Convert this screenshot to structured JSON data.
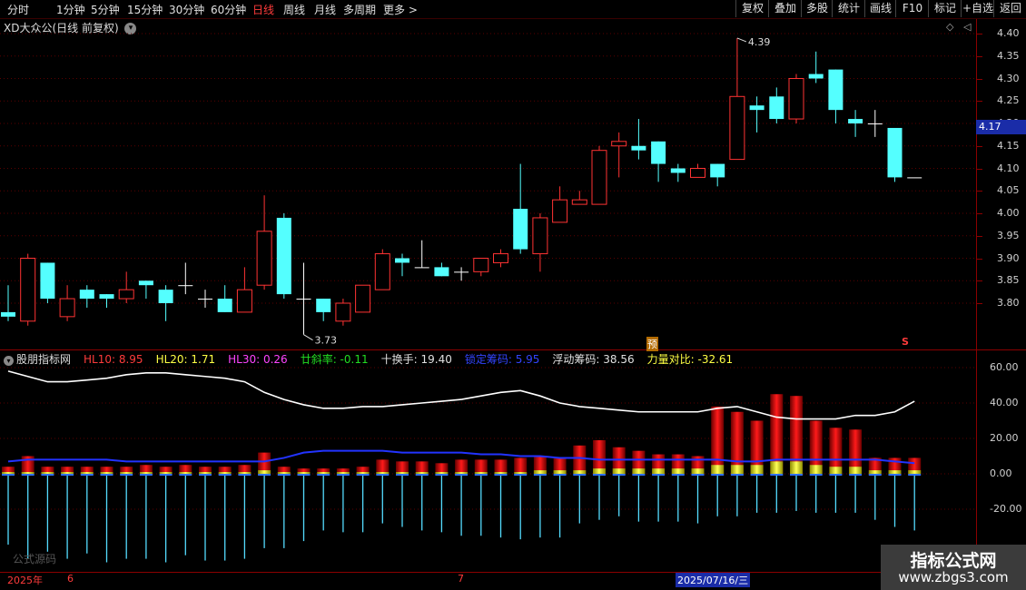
{
  "toolbar": {
    "periods": [
      "分时",
      "1分钟",
      "5分钟",
      "15分钟",
      "30分钟",
      "60分钟",
      "日线",
      "周线",
      "月线",
      "多周期",
      "更多 >"
    ],
    "active_period": "日线",
    "buttons": [
      "复权",
      "叠加",
      "多股",
      "统计",
      "画线",
      "F10",
      "标记",
      "+自选",
      "返回"
    ]
  },
  "chart": {
    "title": "XD大众公(日线 前复权)",
    "current_price_tag": "4.17",
    "high_label": "4.39",
    "low_label": "3.73",
    "marker_pre": "预",
    "marker_s": "S"
  },
  "indicator": {
    "name": "股朋指标网",
    "items": [
      {
        "label": "HL10:",
        "value": "8.95",
        "color": "#ff3b3b"
      },
      {
        "label": "HL20:",
        "value": "1.71",
        "color": "#ffff44"
      },
      {
        "label": "HL30:",
        "value": "0.26",
        "color": "#ff44ff"
      },
      {
        "label": "廿斜率:",
        "value": "-0.11",
        "color": "#22dd22"
      },
      {
        "label": "十换手:",
        "value": "19.40",
        "color": "#e0e0e0"
      },
      {
        "label": "锁定筹码:",
        "value": "5.95",
        "color": "#3344ff"
      },
      {
        "label": "浮动筹码:",
        "value": "38.56",
        "color": "#e0e0e0"
      },
      {
        "label": "力量对比:",
        "value": "-32.61",
        "color": "#ffff44"
      }
    ]
  },
  "dates": {
    "year": "2025年",
    "m6": "6",
    "m7": "7",
    "highlight": "2025/07/16/三"
  },
  "watermark": "公式源码",
  "logo": {
    "line1": "指标公式网",
    "line2": "www.zbgs3.com"
  },
  "chart_data": {
    "type": "candlestick",
    "price_axis": {
      "ticks": [
        3.8,
        3.85,
        3.9,
        3.95,
        4.0,
        4.05,
        4.1,
        4.15,
        4.2,
        4.25,
        4.3,
        4.35,
        4.4
      ],
      "range": [
        3.72,
        4.42
      ]
    },
    "candles": [
      {
        "o": 3.78,
        "h": 3.84,
        "l": 3.76,
        "c": 3.77
      },
      {
        "o": 3.76,
        "h": 3.91,
        "l": 3.75,
        "c": 3.9
      },
      {
        "o": 3.89,
        "h": 3.89,
        "l": 3.8,
        "c": 3.81
      },
      {
        "o": 3.77,
        "h": 3.84,
        "l": 3.76,
        "c": 3.81
      },
      {
        "o": 3.83,
        "h": 3.84,
        "l": 3.79,
        "c": 3.81
      },
      {
        "o": 3.82,
        "h": 3.82,
        "l": 3.79,
        "c": 3.81
      },
      {
        "o": 3.81,
        "h": 3.87,
        "l": 3.8,
        "c": 3.83
      },
      {
        "o": 3.85,
        "h": 3.85,
        "l": 3.81,
        "c": 3.84
      },
      {
        "o": 3.83,
        "h": 3.84,
        "l": 3.76,
        "c": 3.8
      },
      {
        "o": 3.84,
        "h": 3.89,
        "l": 3.82,
        "c": 3.84
      },
      {
        "o": 3.81,
        "h": 3.83,
        "l": 3.79,
        "c": 3.81
      },
      {
        "o": 3.81,
        "h": 3.84,
        "l": 3.78,
        "c": 3.78
      },
      {
        "o": 3.78,
        "h": 3.88,
        "l": 3.78,
        "c": 3.83
      },
      {
        "o": 3.84,
        "h": 4.04,
        "l": 3.83,
        "c": 3.96
      },
      {
        "o": 3.99,
        "h": 4.0,
        "l": 3.81,
        "c": 3.82
      },
      {
        "o": 3.81,
        "h": 3.89,
        "l": 3.73,
        "c": 3.81
      },
      {
        "o": 3.81,
        "h": 3.81,
        "l": 3.76,
        "c": 3.78
      },
      {
        "o": 3.76,
        "h": 3.81,
        "l": 3.75,
        "c": 3.8
      },
      {
        "o": 3.78,
        "h": 3.84,
        "l": 3.78,
        "c": 3.84
      },
      {
        "o": 3.83,
        "h": 3.92,
        "l": 3.83,
        "c": 3.91
      },
      {
        "o": 3.9,
        "h": 3.91,
        "l": 3.86,
        "c": 3.89
      },
      {
        "o": 3.88,
        "h": 3.94,
        "l": 3.88,
        "c": 3.88
      },
      {
        "o": 3.88,
        "h": 3.89,
        "l": 3.86,
        "c": 3.86
      },
      {
        "o": 3.87,
        "h": 3.88,
        "l": 3.85,
        "c": 3.87
      },
      {
        "o": 3.87,
        "h": 3.9,
        "l": 3.86,
        "c": 3.9
      },
      {
        "o": 3.89,
        "h": 3.92,
        "l": 3.88,
        "c": 3.91
      },
      {
        "o": 4.01,
        "h": 4.11,
        "l": 3.91,
        "c": 3.92
      },
      {
        "o": 3.91,
        "h": 4.0,
        "l": 3.87,
        "c": 3.99
      },
      {
        "o": 3.98,
        "h": 4.06,
        "l": 3.98,
        "c": 4.03
      },
      {
        "o": 4.02,
        "h": 4.05,
        "l": 4.02,
        "c": 4.03
      },
      {
        "o": 4.02,
        "h": 4.15,
        "l": 4.02,
        "c": 4.14
      },
      {
        "o": 4.15,
        "h": 4.18,
        "l": 4.08,
        "c": 4.16
      },
      {
        "o": 4.15,
        "h": 4.21,
        "l": 4.12,
        "c": 4.14
      },
      {
        "o": 4.16,
        "h": 4.16,
        "l": 4.07,
        "c": 4.11
      },
      {
        "o": 4.1,
        "h": 4.11,
        "l": 4.07,
        "c": 4.09
      },
      {
        "o": 4.08,
        "h": 4.11,
        "l": 4.08,
        "c": 4.1
      },
      {
        "o": 4.11,
        "h": 4.11,
        "l": 4.06,
        "c": 4.08
      },
      {
        "o": 4.12,
        "h": 4.39,
        "l": 4.12,
        "c": 4.26
      },
      {
        "o": 4.24,
        "h": 4.26,
        "l": 4.18,
        "c": 4.23
      },
      {
        "o": 4.26,
        "h": 4.28,
        "l": 4.2,
        "c": 4.21
      },
      {
        "o": 4.21,
        "h": 4.31,
        "l": 4.2,
        "c": 4.3
      },
      {
        "o": 4.31,
        "h": 4.36,
        "l": 4.29,
        "c": 4.3
      },
      {
        "o": 4.32,
        "h": 4.32,
        "l": 4.2,
        "c": 4.23
      },
      {
        "o": 4.21,
        "h": 4.23,
        "l": 4.17,
        "c": 4.2
      },
      {
        "o": 4.2,
        "h": 4.23,
        "l": 4.17,
        "c": 4.2
      },
      {
        "o": 4.19,
        "h": 4.19,
        "l": 4.07,
        "c": 4.08
      },
      {
        "o": 4.08,
        "h": 4.08,
        "l": 4.08,
        "c": 4.08
      }
    ],
    "indicator_axis": {
      "ticks": [
        60,
        40,
        20,
        0,
        -20
      ],
      "range": [
        -52,
        66
      ]
    },
    "white_line": [
      58,
      55,
      52,
      52,
      53,
      54,
      56,
      57,
      57,
      56,
      55,
      54,
      52,
      46,
      42,
      39,
      37,
      37,
      38,
      38,
      39,
      40,
      41,
      42,
      44,
      46,
      47,
      44,
      40,
      38,
      37,
      36,
      35,
      35,
      35,
      35,
      37,
      38,
      35,
      32,
      31,
      31,
      31,
      33,
      33,
      35,
      41
    ],
    "blue_line": [
      7,
      8,
      8,
      8,
      8,
      8,
      7,
      7,
      7,
      7,
      7,
      7,
      7,
      7,
      9,
      12,
      13,
      13,
      13,
      13,
      12,
      12,
      12,
      12,
      11,
      11,
      10,
      10,
      9,
      9,
      8,
      8,
      8,
      8,
      8,
      8,
      8,
      7,
      7,
      8,
      8,
      8,
      8,
      8,
      8,
      7,
      6
    ],
    "red_bars": [
      4,
      10,
      4,
      4,
      4,
      4,
      4,
      5,
      4,
      5,
      4,
      4,
      5,
      12,
      4,
      3,
      3,
      3,
      4,
      8,
      7,
      7,
      6,
      8,
      8,
      8,
      9,
      10,
      9,
      16,
      19,
      15,
      13,
      11,
      11,
      10,
      38,
      35,
      30,
      45,
      44,
      30,
      26,
      25,
      9,
      9,
      9
    ],
    "yellow_bars": [
      1,
      1,
      1,
      1,
      1,
      1,
      1,
      1,
      1,
      1,
      1,
      1,
      1,
      2,
      1,
      1,
      1,
      1,
      1,
      1,
      1,
      1,
      1,
      1,
      1,
      1,
      1,
      2,
      2,
      2,
      3,
      3,
      3,
      3,
      3,
      3,
      5,
      5,
      5,
      7,
      7,
      5,
      4,
      4,
      2,
      2,
      2
    ],
    "cyan_drops": [
      -40,
      -48,
      -44,
      -48,
      -45,
      -50,
      -48,
      -48,
      -50,
      -46,
      -49,
      -49,
      -48,
      -42,
      -42,
      -38,
      -32,
      -33,
      -33,
      -28,
      -30,
      -32,
      -33,
      -35,
      -35,
      -36,
      -37,
      -36,
      -36,
      -28,
      -26,
      -24,
      -27,
      -27,
      -27,
      -28,
      -24,
      -24,
      -22,
      -22,
      -21,
      -22,
      -22,
      -22,
      -26,
      -30,
      -32
    ]
  }
}
